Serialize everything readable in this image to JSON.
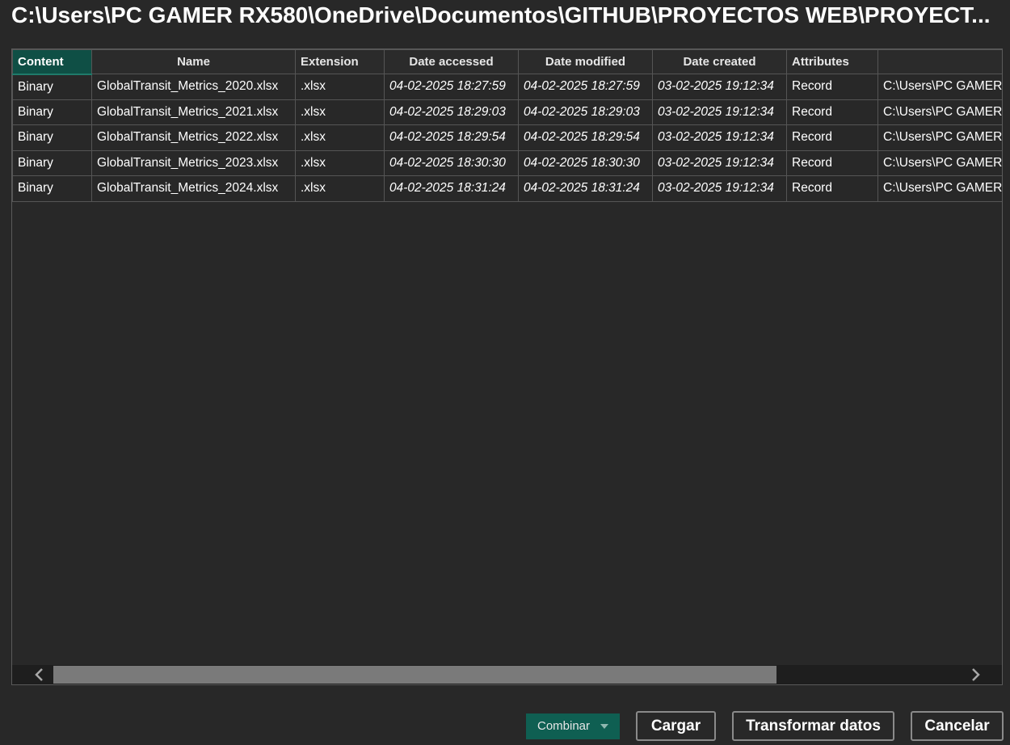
{
  "window": {
    "title": "C:\\Users\\PC GAMER RX580\\OneDrive\\Documentos\\GITHUB\\PROYECTOS WEB\\PROYECT..."
  },
  "table": {
    "columns": [
      "Content",
      "Name",
      "Extension",
      "Date accessed",
      "Date modified",
      "Date created",
      "Attributes",
      ""
    ],
    "rows": [
      [
        "Binary",
        "GlobalTransit_Metrics_2020.xlsx",
        ".xlsx",
        "04-02-2025 18:27:59",
        "04-02-2025 18:27:59",
        "03-02-2025 19:12:34",
        "Record",
        "C:\\Users\\PC GAMER"
      ],
      [
        "Binary",
        "GlobalTransit_Metrics_2021.xlsx",
        ".xlsx",
        "04-02-2025 18:29:03",
        "04-02-2025 18:29:03",
        "03-02-2025 19:12:34",
        "Record",
        "C:\\Users\\PC GAMER"
      ],
      [
        "Binary",
        "GlobalTransit_Metrics_2022.xlsx",
        ".xlsx",
        "04-02-2025 18:29:54",
        "04-02-2025 18:29:54",
        "03-02-2025 19:12:34",
        "Record",
        "C:\\Users\\PC GAMER"
      ],
      [
        "Binary",
        "GlobalTransit_Metrics_2023.xlsx",
        ".xlsx",
        "04-02-2025 18:30:30",
        "04-02-2025 18:30:30",
        "03-02-2025 19:12:34",
        "Record",
        "C:\\Users\\PC GAMER"
      ],
      [
        "Binary",
        "GlobalTransit_Metrics_2024.xlsx",
        ".xlsx",
        "04-02-2025 18:31:24",
        "04-02-2025 18:31:24",
        "03-02-2025 19:12:34",
        "Record",
        "C:\\Users\\PC GAMER"
      ]
    ],
    "selected_column": "Content"
  },
  "scrollbar": {
    "left_icon": "chevron-left-icon",
    "right_icon": "chevron-right-icon",
    "thumb_fraction": 0.76
  },
  "footer": {
    "combinar_label": "Combinar",
    "combinar_icon": "caret-down-icon",
    "cargar_label": "Cargar",
    "transformar_label": "Transformar datos",
    "cancelar_label": "Cancelar"
  },
  "colors": {
    "accent": "#0f5f52",
    "background": "#282828"
  }
}
